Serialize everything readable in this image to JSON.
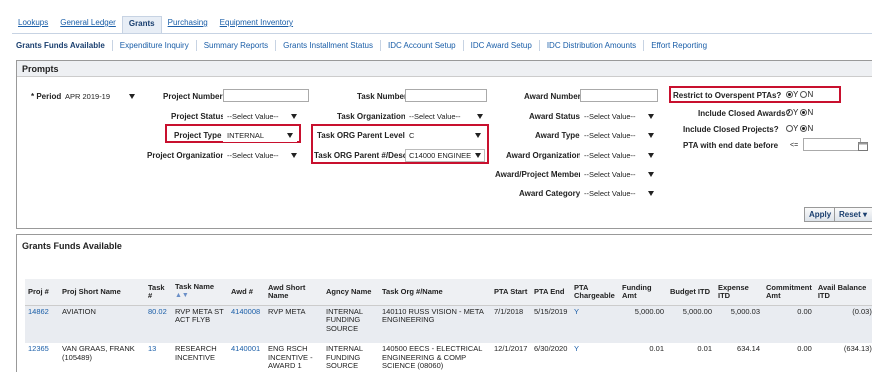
{
  "top_tabs": [
    "Lookups",
    "General Ledger",
    "Grants",
    "Purchasing",
    "Equipment Inventory"
  ],
  "sub_tabs": [
    "Grants Funds Available",
    "Expenditure Inquiry",
    "Summary Reports",
    "Grants Installment Status",
    "IDC Account Setup",
    "IDC Award Setup",
    "IDC Distribution Amounts",
    "Effort Reporting"
  ],
  "prompts": {
    "title": "Prompts",
    "period_label": "* Period",
    "period_value": "APR 2019-19",
    "project_number_label": "Project Number",
    "project_status_label": "Project Status",
    "project_status_value": "--Select Value--",
    "project_type_label": "Project Type",
    "project_type_value": "INTERNAL",
    "project_org_label": "Project Organization",
    "project_org_value": "--Select Value--",
    "task_number_label": "Task Number",
    "task_org_label": "Task Organization",
    "task_org_value": "--Select Value--",
    "task_org_parent_level_label": "Task ORG Parent Level",
    "task_org_parent_level_value": "C",
    "task_org_parent_desc_label": "Task ORG Parent #/Desc",
    "task_org_parent_desc_value": "C14000 ENGINEE",
    "award_number_label": "Award Number",
    "award_status_label": "Award Status",
    "award_status_value": "--Select Value--",
    "award_type_label": "Award Type",
    "award_type_value": "--Select Value--",
    "award_org_label": "Award Organization",
    "award_org_value": "--Select Value--",
    "award_member_label": "Award/Project Member",
    "award_member_value": "--Select Value--",
    "award_category_label": "Award Category",
    "award_category_value": "--Select Value--",
    "restrict_label": "Restrict to Overspent PTAs?",
    "include_closed_awards_label": "Include Closed Awards?",
    "include_closed_projects_label": "Include Closed Projects?",
    "pta_end_label": "PTA with end date before",
    "pta_end_op": "<=",
    "y": "Y",
    "n": "N",
    "apply": "Apply",
    "reset": "Reset ▾"
  },
  "results": {
    "title": "Grants Funds Available",
    "columns": [
      "Proj #",
      "Proj Short Name",
      "Task #",
      "Task Name",
      "Awd #",
      "Awd Short Name",
      "Agncy Name",
      "Task Org #/Name",
      "PTA Start",
      "PTA End",
      "PTA Chargeable",
      "Funding Amt",
      "Budget ITD",
      "Expense ITD",
      "Commitment Amt",
      "Avail Balance ITD"
    ],
    "rows": [
      [
        "14862",
        "AVIATION",
        "80.02",
        "RVP META ST ACT FLYB",
        "4140008",
        "RVP META",
        "INTERNAL FUNDING SOURCE",
        "140110 RUSS VISION - META ENGINEERING",
        "7/1/2018",
        "5/15/2019",
        "Y",
        "5,000.00",
        "5,000.00",
        "5,000.03",
        "0.00",
        "(0.03)"
      ],
      [
        "12365",
        "VAN GRAAS, FRANK (105489)",
        "13",
        "RESEARCH INCENTIVE",
        "4140001",
        "ENG RSCH INCENTIVE - AWARD 1",
        "INTERNAL FUNDING SOURCE",
        "140500 EECS - ELECTRICAL ENGINEERING & COMP SCIENCE (08060)",
        "12/1/2017",
        "6/30/2020",
        "Y",
        "0.01",
        "0.01",
        "634.14",
        "0.00",
        "(634.13)"
      ]
    ]
  }
}
